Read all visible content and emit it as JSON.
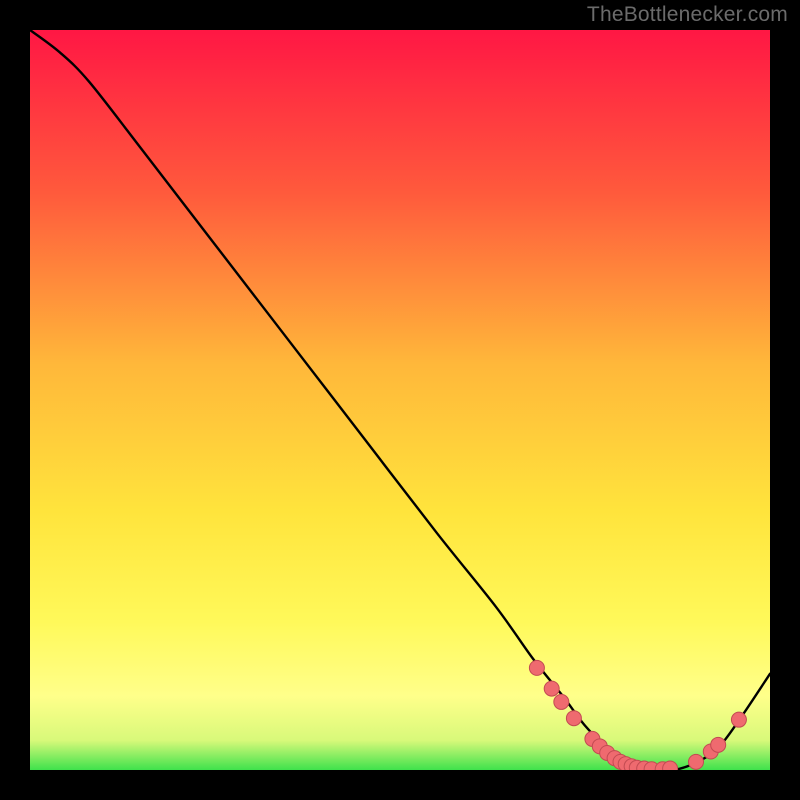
{
  "attribution": "TheBottlenecker.com",
  "colors": {
    "background": "#000000",
    "gradient_top": "#ff1744",
    "gradient_mid1": "#ff6338",
    "gradient_mid2": "#ffb73a",
    "gradient_mid3": "#ffe43c",
    "gradient_mid4": "#fdfb5b",
    "gradient_bottom_band": "#ffff8a",
    "gradient_green": "#3fe24c",
    "curve": "#000000",
    "marker_fill": "#ef6a6f",
    "marker_stroke": "#c24b52"
  },
  "chart_data": {
    "type": "line",
    "title": "",
    "xlabel": "",
    "ylabel": "",
    "xlim": [
      0,
      100
    ],
    "ylim": [
      0,
      100
    ],
    "series": [
      {
        "name": "bottleneck-curve",
        "x": [
          0,
          4,
          8,
          15,
          25,
          35,
          45,
          55,
          63,
          68,
          72,
          75,
          78,
          81,
          84,
          87,
          90,
          93,
          96,
          100
        ],
        "y": [
          100,
          97,
          93,
          84,
          71,
          58,
          45,
          32,
          22,
          15,
          10,
          6,
          3,
          1,
          0,
          0,
          1,
          3,
          7,
          13
        ]
      }
    ],
    "markers": [
      {
        "x": 68.5,
        "y": 13.8
      },
      {
        "x": 70.5,
        "y": 11.0
      },
      {
        "x": 71.8,
        "y": 9.2
      },
      {
        "x": 73.5,
        "y": 7.0
      },
      {
        "x": 76.0,
        "y": 4.2
      },
      {
        "x": 77.0,
        "y": 3.2
      },
      {
        "x": 78.0,
        "y": 2.3
      },
      {
        "x": 79.0,
        "y": 1.6
      },
      {
        "x": 79.8,
        "y": 1.1
      },
      {
        "x": 80.5,
        "y": 0.8
      },
      {
        "x": 81.3,
        "y": 0.5
      },
      {
        "x": 82.0,
        "y": 0.3
      },
      {
        "x": 83.0,
        "y": 0.2
      },
      {
        "x": 84.0,
        "y": 0.1
      },
      {
        "x": 85.5,
        "y": 0.1
      },
      {
        "x": 86.5,
        "y": 0.2
      },
      {
        "x": 90.0,
        "y": 1.1
      },
      {
        "x": 92.0,
        "y": 2.5
      },
      {
        "x": 93.0,
        "y": 3.4
      },
      {
        "x": 95.8,
        "y": 6.8
      }
    ]
  }
}
